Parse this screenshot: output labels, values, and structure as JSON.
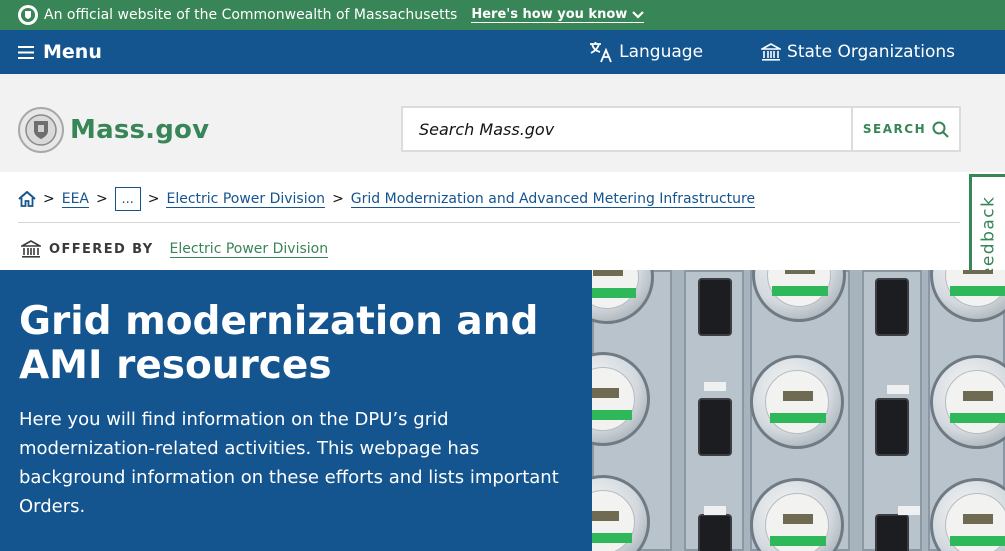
{
  "official_banner": {
    "text": "An official website of the Commonwealth of Massachusetts",
    "link": "Here's how you know"
  },
  "navbar": {
    "menu_label": "Menu",
    "language_label": "Language",
    "state_orgs_label": "State Organizations"
  },
  "header": {
    "logo_text": "Mass.gov",
    "search_placeholder": "Search Mass.gov",
    "search_button": "SEARCH"
  },
  "breadcrumb": {
    "items": [
      "EEA",
      "...",
      "Electric Power Division",
      "Grid Modernization and Advanced Metering Infrastructure"
    ]
  },
  "offered_by": {
    "label": "OFFERED BY",
    "org": "Electric Power Division"
  },
  "feedback_label": "Feedback",
  "hero": {
    "title": "Grid modernization and AMI resources",
    "description": "Here you will find information on the DPU’s grid modernization-related activities. This webpage has background information on these efforts and lists important Orders."
  },
  "colors": {
    "green": "#388557",
    "blue": "#14558f",
    "header_bg": "#f2f2f2"
  },
  "icons": [
    "seal-icon",
    "chevron-down-icon",
    "hamburger-icon",
    "translate-icon",
    "building-icon",
    "search-icon",
    "home-icon",
    "capitol-icon"
  ]
}
